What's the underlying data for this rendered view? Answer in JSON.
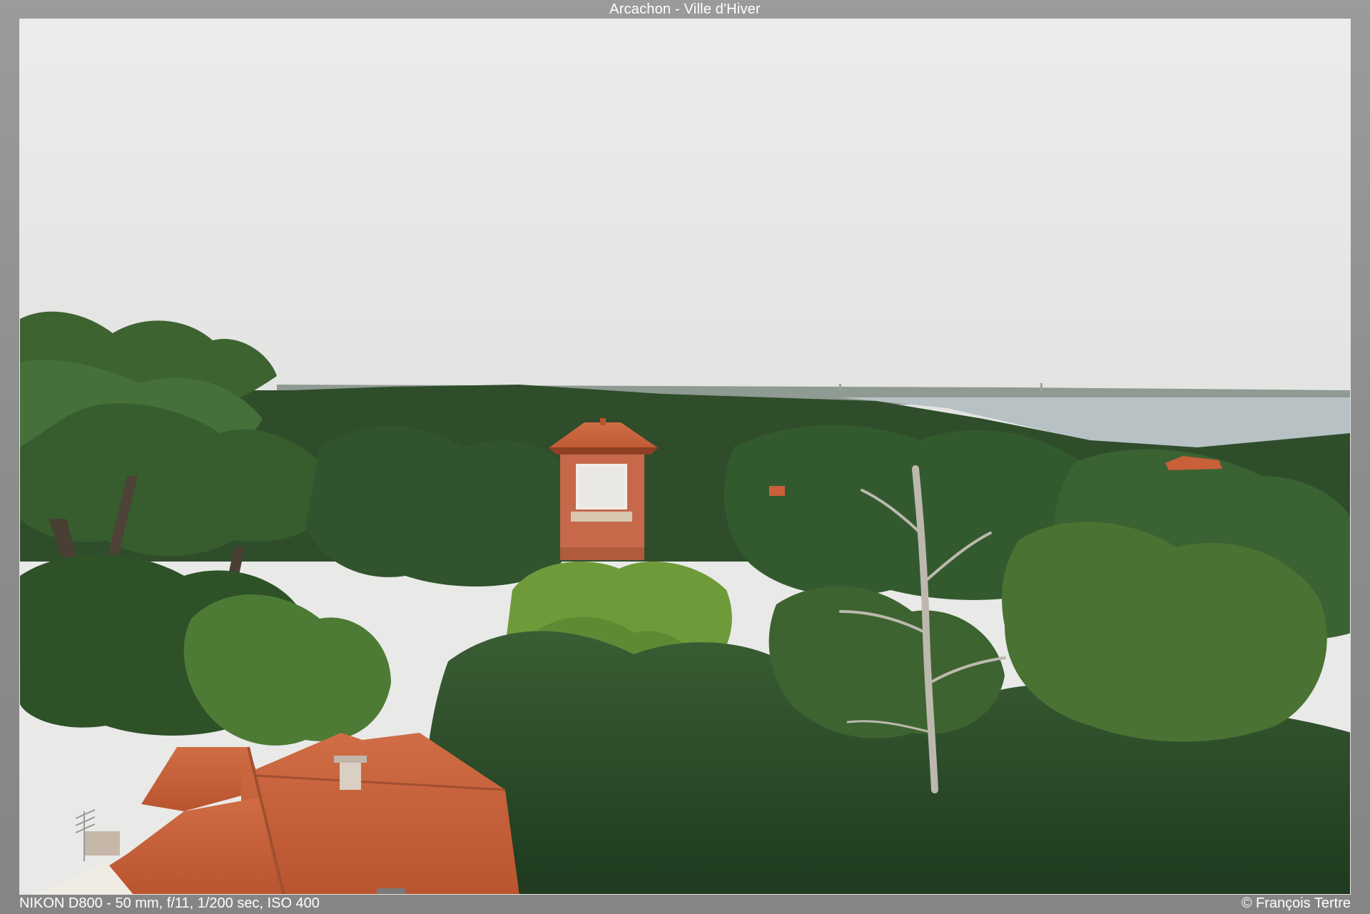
{
  "header": {
    "title": "Arcachon - Ville d'Hiver"
  },
  "footer": {
    "exif": "NIKON D800 - 50 mm, f/11, 1/200 sec, ISO 400",
    "copyright": "© François Tertre"
  },
  "colors": {
    "frame_gray": "#8d8d8d",
    "sky": "#e8e8e7",
    "bay_water": "#b9c2c6",
    "forest_dark": "#2f4d2b",
    "forest_mid": "#3f6a34",
    "foliage_light": "#6f9a3a",
    "roof_terracotta": "#c9603a",
    "villa_brick": "#c5694a"
  }
}
